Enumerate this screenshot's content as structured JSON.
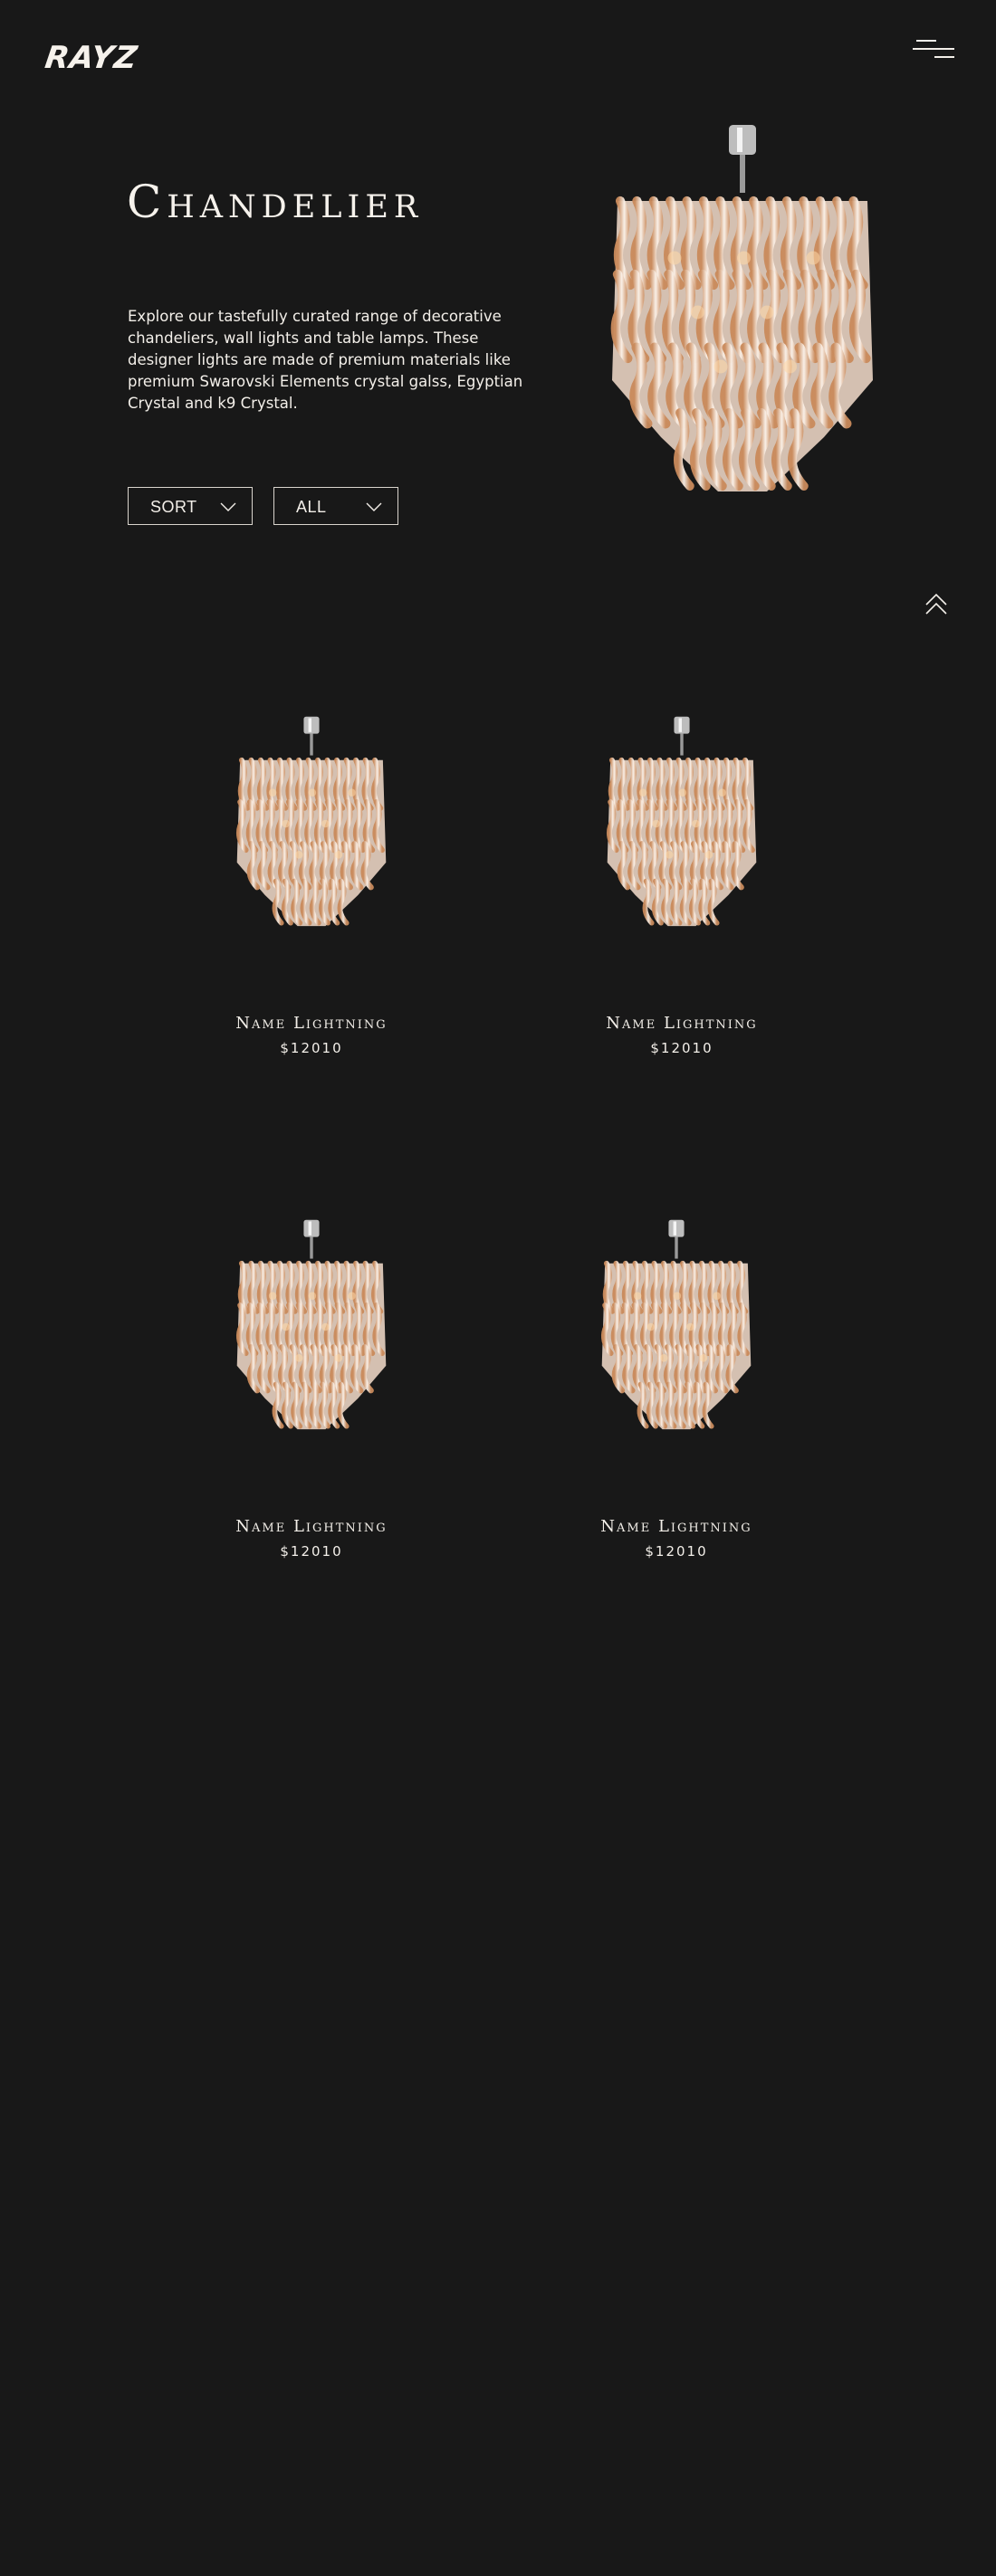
{
  "header": {
    "logo": "RAYZ",
    "menu_icon": "hamburger-menu-icon"
  },
  "hero": {
    "title": "Chandelier",
    "description": "Explore our tastefully curated range of decorative chandeliers, wall lights and table lamps. These designer lights are made of premium materials like premium Swarovski Elements crystal galss, Egyptian Crystal and k9 Crystal.",
    "image_icon": "chandelier-image"
  },
  "filters": {
    "sort_label": "SORT",
    "category_label": "ALL"
  },
  "scroll_top_icon": "double-chevron-up-icon",
  "products": [
    {
      "name": "Name Lightning",
      "price": "$12010"
    },
    {
      "name": "Name Lightning",
      "price": "$12010"
    },
    {
      "name": "Name Lightning",
      "price": "$12010"
    },
    {
      "name": "Name Lightning",
      "price": "$12010"
    }
  ],
  "colors": {
    "background": "#181818",
    "text": "#f3efe9",
    "border": "#d9d4cd",
    "crystal": "#e9d3c2",
    "amber": "#c98a5b",
    "metal": "#bdbdbd"
  }
}
